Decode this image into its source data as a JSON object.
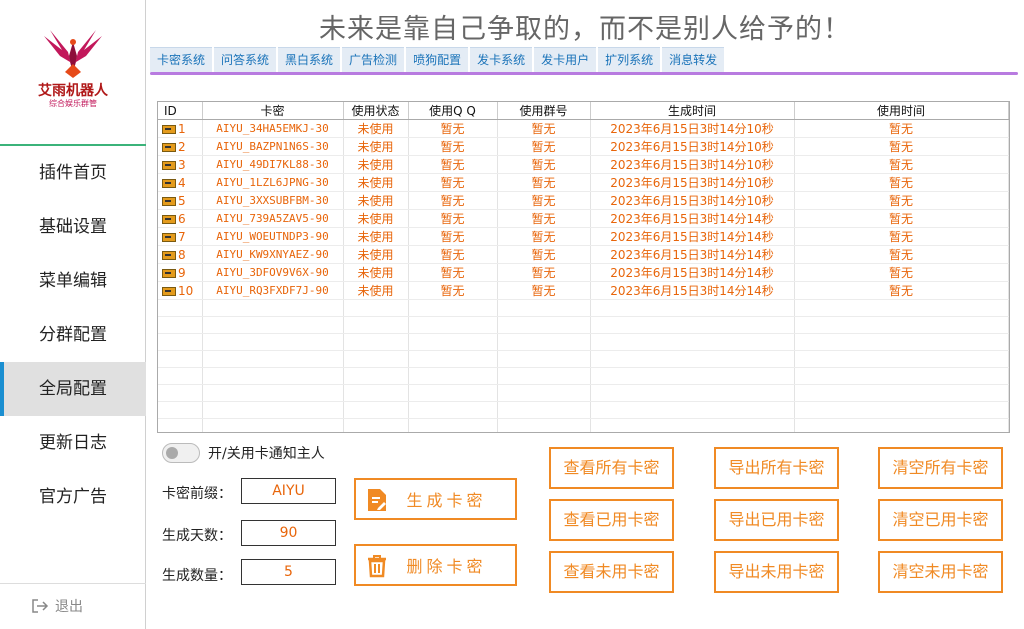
{
  "sidebar": {
    "brand": "艾雨机器人",
    "brand_sub": "综合娱乐群管",
    "items": [
      {
        "label": "插件首页"
      },
      {
        "label": "基础设置"
      },
      {
        "label": "菜单编辑"
      },
      {
        "label": "分群配置"
      },
      {
        "label": "全局配置",
        "active": true
      },
      {
        "label": "更新日志"
      },
      {
        "label": "官方广告"
      }
    ],
    "logout_label": "退出"
  },
  "header": {
    "slogan": "未来是靠自己争取的，而不是别人给予的！"
  },
  "tabs": [
    "卡密系统",
    "问答系统",
    "黑白系统",
    "广告检测",
    "喷狗配置",
    "发卡系统",
    "发卡用户",
    "扩列系统",
    "消息转发"
  ],
  "table": {
    "columns": [
      "ID",
      "卡密",
      "使用状态",
      "使用Q Q",
      "使用群号",
      "生成时间",
      "使用时间"
    ],
    "rows": [
      [
        "1",
        "AIYU_34HA5EMKJ-30",
        "未使用",
        "暂无",
        "暂无",
        "2023年6月15日3时14分10秒",
        "暂无"
      ],
      [
        "2",
        "AIYU_BAZPN1N6S-30",
        "未使用",
        "暂无",
        "暂无",
        "2023年6月15日3时14分10秒",
        "暂无"
      ],
      [
        "3",
        "AIYU_49DI7KL88-30",
        "未使用",
        "暂无",
        "暂无",
        "2023年6月15日3时14分10秒",
        "暂无"
      ],
      [
        "4",
        "AIYU_1LZL6JPNG-30",
        "未使用",
        "暂无",
        "暂无",
        "2023年6月15日3时14分10秒",
        "暂无"
      ],
      [
        "5",
        "AIYU_3XXSUBFBM-30",
        "未使用",
        "暂无",
        "暂无",
        "2023年6月15日3时14分10秒",
        "暂无"
      ],
      [
        "6",
        "AIYU_739A5ZAV5-90",
        "未使用",
        "暂无",
        "暂无",
        "2023年6月15日3时14分14秒",
        "暂无"
      ],
      [
        "7",
        "AIYU_WOEUTNDP3-90",
        "未使用",
        "暂无",
        "暂无",
        "2023年6月15日3时14分14秒",
        "暂无"
      ],
      [
        "8",
        "AIYU_KW9XNYAEZ-90",
        "未使用",
        "暂无",
        "暂无",
        "2023年6月15日3时14分14秒",
        "暂无"
      ],
      [
        "9",
        "AIYU_3DFOV9V6X-90",
        "未使用",
        "暂无",
        "暂无",
        "2023年6月15日3时14分14秒",
        "暂无"
      ],
      [
        "10",
        "AIYU_RQ3FXDF7J-90",
        "未使用",
        "暂无",
        "暂无",
        "2023年6月15日3时14分14秒",
        "暂无"
      ]
    ]
  },
  "controls": {
    "toggle_label": "开/关用卡通知主人",
    "prefix_label": "卡密前缀：",
    "prefix_value": "AIYU",
    "days_label": "生成天数：",
    "days_value": "90",
    "count_label": "生成数量：",
    "count_value": "5",
    "generate_label": "生成卡密",
    "delete_label": "删除卡密",
    "view_all": "查看所有卡密",
    "view_used": "查看已用卡密",
    "view_unused": "查看未用卡密",
    "export_all": "导出所有卡密",
    "export_used": "导出已用卡密",
    "export_unused": "导出未用卡密",
    "clear_all": "清空所有卡密",
    "clear_used": "清空已用卡密",
    "clear_unused": "清空未用卡密"
  },
  "colors": {
    "accent": "#f08a24",
    "text_orange": "#e8650a",
    "active_indicator": "#1b8fd1",
    "tab_underline": "#b87be0"
  }
}
